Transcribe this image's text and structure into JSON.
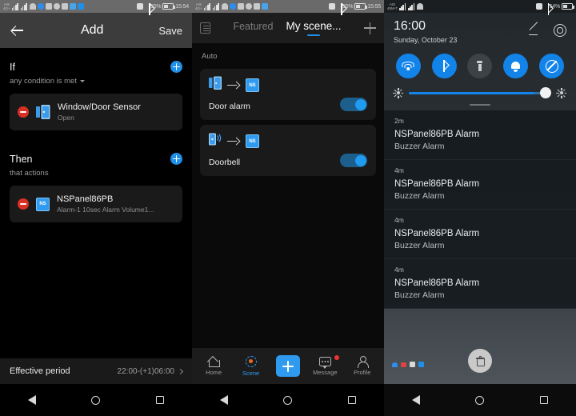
{
  "panel1": {
    "statusbar": {
      "carrier_line1": "AIS",
      "carrier_line2": "4G+",
      "battery": "55%",
      "clock": "15:54"
    },
    "topbar": {
      "title": "Add",
      "save_label": "Save",
      "back_icon": "back-arrow-icon"
    },
    "if_section": {
      "title": "If",
      "subtitle": "any condition is met",
      "add_icon": "plus-circle-icon",
      "card": {
        "name": "Window/Door Sensor",
        "state": "Open",
        "remove_icon": "minus-circle-icon",
        "device_icon": "door-sensor-icon"
      }
    },
    "then_section": {
      "title": "Then",
      "subtitle": "that actions",
      "add_icon": "plus-circle-icon",
      "card": {
        "name": "NSPanel86PB",
        "state": "Alarm-1  10sec  Alarm Volume1...",
        "remove_icon": "minus-circle-icon",
        "device_icon": "ns-chip-icon",
        "device_badge": "NS"
      }
    },
    "effective_period": {
      "label": "Effective period",
      "value": "22:00-(+1)06:00"
    }
  },
  "panel2": {
    "statusbar": {
      "carrier_line1": "AIS",
      "carrier_line2": "4G+",
      "battery": "55%",
      "clock": "15:55"
    },
    "topbar": {
      "menu_icon": "list-icon",
      "add_icon": "plus-icon",
      "tabs": [
        {
          "label": "Featured",
          "active": false
        },
        {
          "label": "My scene...",
          "active": true
        }
      ]
    },
    "group_label": "Auto",
    "scenes": [
      {
        "name": "Door alarm",
        "enabled": true,
        "from_icon": "door-sensor-icon",
        "to_icon": "ns-chip-icon",
        "to_badge": "NS"
      },
      {
        "name": "Doorbell",
        "enabled": true,
        "from_icon": "doorbell-icon",
        "to_icon": "ns-chip-icon",
        "to_badge": "NS"
      }
    ],
    "bottom_nav": [
      {
        "label": "Home",
        "icon": "home-icon",
        "active": false
      },
      {
        "label": "Scene",
        "icon": "scene-icon",
        "active": true
      },
      {
        "label": "",
        "icon": "add-fab-icon",
        "active": false
      },
      {
        "label": "Message",
        "icon": "message-icon",
        "active": false,
        "badge": true
      },
      {
        "label": "Profile",
        "icon": "profile-icon",
        "active": false
      }
    ]
  },
  "panel3": {
    "statusbar": {
      "carrier_line1": "AIS",
      "carrier_line2": "45M-T",
      "battery": "54%"
    },
    "clock": {
      "time": "16:00",
      "date": "Sunday, October 23"
    },
    "header_actions": [
      {
        "icon": "edit-pencil-icon"
      },
      {
        "icon": "gear-icon"
      }
    ],
    "quick_settings": [
      {
        "icon": "wifi-icon",
        "on": true
      },
      {
        "icon": "bluetooth-icon",
        "on": true
      },
      {
        "icon": "flashlight-icon",
        "on": false
      },
      {
        "icon": "bell-icon",
        "on": true
      },
      {
        "icon": "do-not-disturb-icon",
        "on": true
      }
    ],
    "brightness": {
      "left_icon": "brightness-low-icon",
      "right_icon": "brightness-high-icon",
      "value": 88
    },
    "notifications": [
      {
        "time": "2m",
        "title": "NSPanel86PB Alarm",
        "body": "Buzzer Alarm"
      },
      {
        "time": "4m",
        "title": "NSPanel86PB Alarm",
        "body": "Buzzer Alarm"
      },
      {
        "time": "4m",
        "title": "NSPanel86PB Alarm",
        "body": "Buzzer Alarm"
      },
      {
        "time": "4m",
        "title": "NSPanel86PB Alarm",
        "body": "Buzzer Alarm"
      }
    ],
    "clear_all_icon": "trash-icon",
    "tray_icons": [
      "cloud-icon",
      "gmail-icon",
      "screenshot-icon",
      "app-icon"
    ]
  },
  "colors": {
    "accent_blue": "#1f8fe8",
    "qs_blue": "#1283e8",
    "danger_red": "#d93025",
    "card_dark": "#1a1a1a"
  }
}
